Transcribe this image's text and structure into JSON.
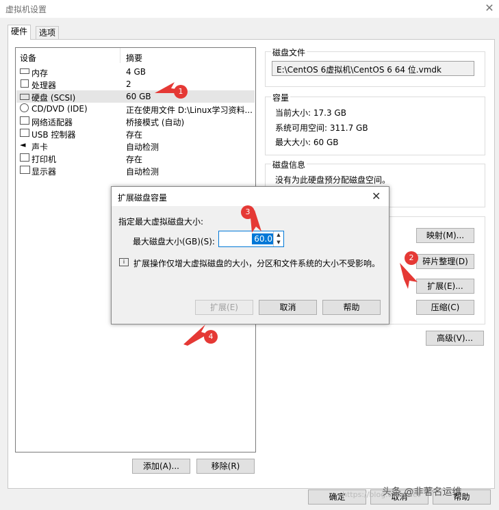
{
  "window": {
    "title": "虚拟机设置"
  },
  "tabs": [
    {
      "label": "硬件"
    },
    {
      "label": "选项"
    }
  ],
  "device_table": {
    "columns": [
      "设备",
      "摘要"
    ],
    "rows": [
      {
        "icon": "memory-icon",
        "name": "内存",
        "summary": "4 GB"
      },
      {
        "icon": "cpu-icon",
        "name": "处理器",
        "summary": "2"
      },
      {
        "icon": "hard-disk-icon",
        "name": "硬盘 (SCSI)",
        "summary": "60 GB",
        "selected": true
      },
      {
        "icon": "cd-dvd-icon",
        "name": "CD/DVD (IDE)",
        "summary": "正在使用文件 D:\\Linux学习资料..."
      },
      {
        "icon": "network-adapter-icon",
        "name": "网络适配器",
        "summary": "桥接模式 (自动)"
      },
      {
        "icon": "usb-icon",
        "name": "USB 控制器",
        "summary": "存在"
      },
      {
        "icon": "sound-card-icon",
        "name": "声卡",
        "summary": "自动检测"
      },
      {
        "icon": "printer-icon",
        "name": "打印机",
        "summary": "存在"
      },
      {
        "icon": "display-icon",
        "name": "显示器",
        "summary": "自动检测"
      }
    ]
  },
  "bottom_buttons": {
    "add": "添加(A)...",
    "remove": "移除(R)"
  },
  "disk_file": {
    "title": "磁盘文件",
    "path": "E:\\CentOS 6虚拟机\\CentOS 6 64 位.vmdk"
  },
  "capacity": {
    "title": "容量",
    "current_size": "当前大小: 17.3 GB",
    "free_space": "系统可用空间: 311.7 GB",
    "max_size": "最大大小: 60 GB"
  },
  "disk_info": {
    "title": "磁盘信息",
    "text": "没有为此硬盘预分配磁盘空间。"
  },
  "utilities": {
    "map": "映射(M)...",
    "defrag": "碎片整理(D)",
    "expand": "扩展(E)...",
    "compact": "压缩(C)"
  },
  "advanced_button": "高级(V)...",
  "footer": {
    "ok": "确定",
    "cancel": "取消",
    "help": "帮助"
  },
  "dialog": {
    "title": "扩展磁盘容量",
    "instruction": "指定最大虚拟磁盘大小:",
    "field_label": "最大磁盘大小(GB)(S):",
    "field_value": "60.0",
    "note": "扩展操作仅增大虚拟磁盘的大小，分区和文件系统的大小不受影响。",
    "expand": "扩展(E)",
    "cancel": "取消",
    "help": "帮助"
  },
  "annotations": {
    "accent": "#e53935",
    "badges": [
      "1",
      "2",
      "3",
      "4"
    ]
  },
  "watermark": {
    "blog": "https://blog.csdn.net",
    "author": "头条 @非著名运维"
  }
}
